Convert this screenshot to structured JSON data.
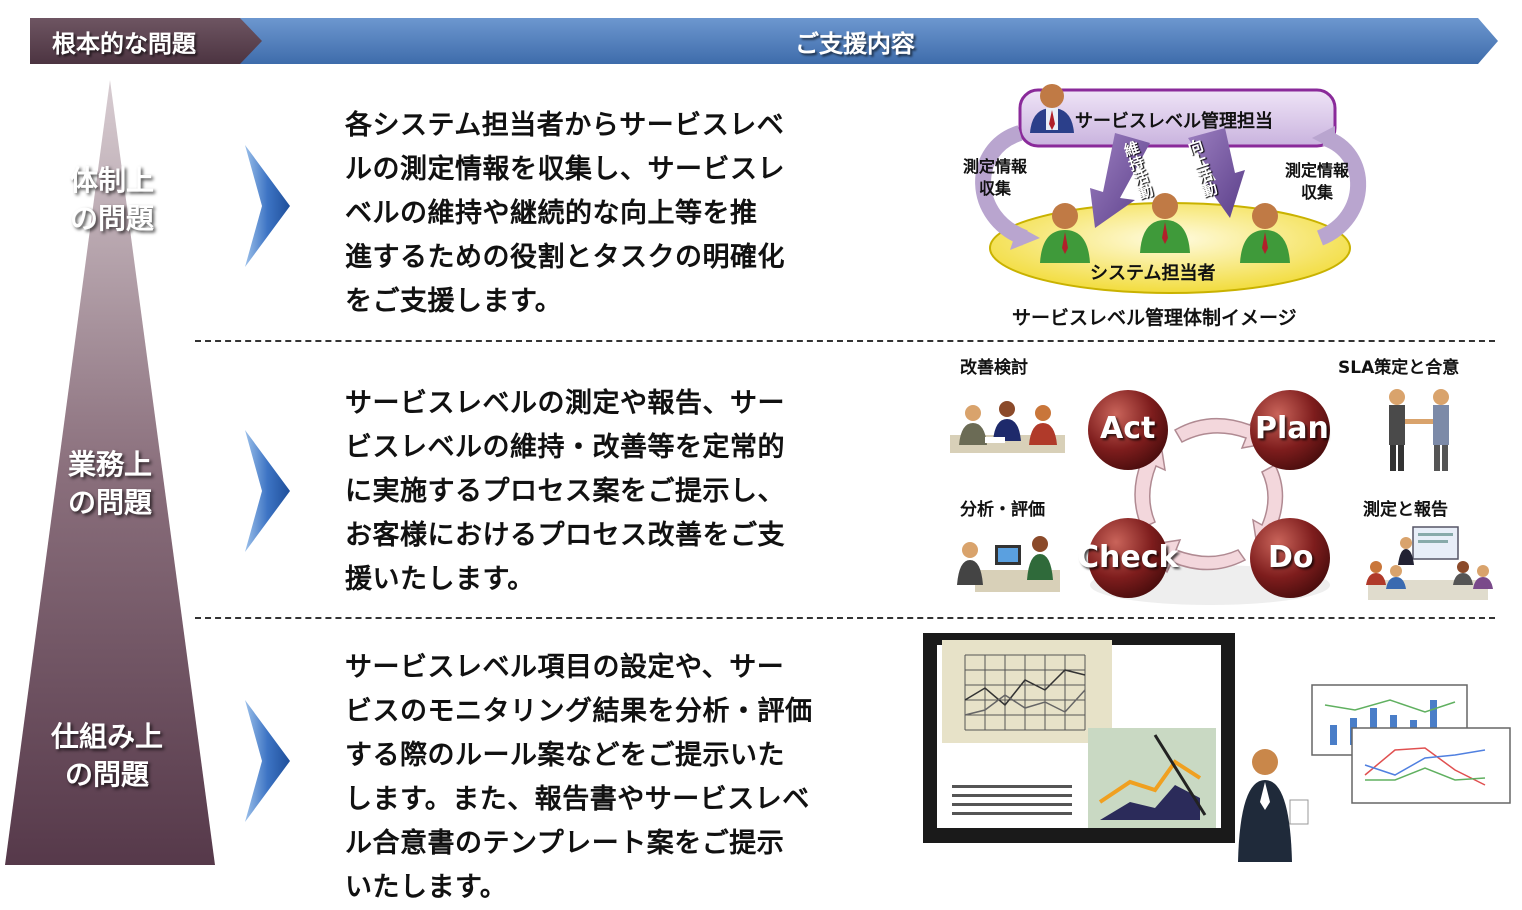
{
  "header": {
    "left_label": "根本的な問題",
    "right_label": "ご支援内容"
  },
  "problems": [
    {
      "line1": "体制上",
      "line2": "の問題"
    },
    {
      "line1": "業務上",
      "line2": "の問題"
    },
    {
      "line1": "仕組み上",
      "line2": "の問題"
    }
  ],
  "descriptions": [
    {
      "lines": [
        "各システム担当者からサービスレベ",
        "ルの測定情報を収集し、サービスレ",
        "ベルの維持や継続的な向上等を推",
        "進するための役割とタスクの明確化",
        "をご支援します。"
      ]
    },
    {
      "lines": [
        "サービスレベルの測定や報告、サー",
        "ビスレベルの維持・改善等を定常的",
        "に実施するプロセス案をご提示し、",
        "お客様におけるプロセス改善をご支",
        "援いたします。"
      ]
    },
    {
      "lines": [
        "サービスレベル項目の設定や、サー",
        "ビスのモニタリング結果を分析・評価",
        "する際のルール案などをご提示いた",
        "します。また、報告書やサービスレベ",
        "ル合意書のテンプレート案をご提示",
        "いたします。"
      ]
    }
  ],
  "org_diagram": {
    "manager_label": "サービスレベル管理担当",
    "left_collect_1": "測定情報",
    "left_collect_2": "収集",
    "right_collect_1": "測定情報",
    "right_collect_2": "収集",
    "maintain_label": "維持活動",
    "improve_label": "向上活動",
    "staff_label": "システム担当者",
    "caption": "サービスレベル管理体制イメージ"
  },
  "pdca": {
    "act": "Act",
    "plan": "Plan",
    "check": "Check",
    "do": "Do",
    "improve_review": "改善検討",
    "sla_agreement": "SLA策定と合意",
    "analysis_eval": "分析・評価",
    "measure_report": "測定と報告"
  },
  "colors": {
    "header_left": "#5a4250",
    "header_right": "#4a78b5",
    "pyramid_top": "#c8b8c0",
    "pyramid_bottom": "#5a3e4c",
    "arrow_blue": "#2f63b3",
    "pdca_circle": "#7a1a1a"
  }
}
